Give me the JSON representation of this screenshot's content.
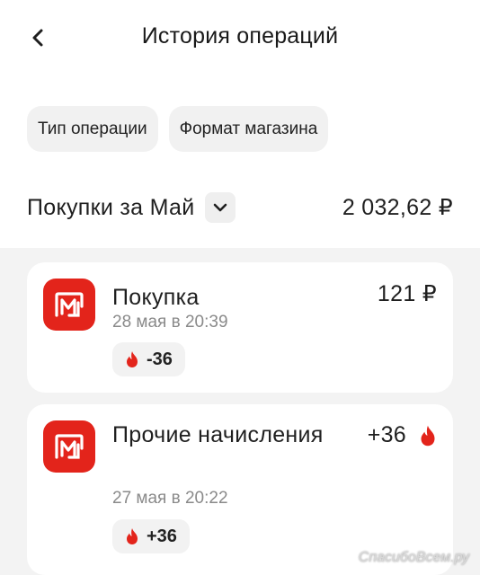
{
  "header": {
    "title": "История операций"
  },
  "filters": [
    {
      "label": "Тип операции"
    },
    {
      "label": "Формат магазина"
    }
  ],
  "summary": {
    "title": "Покупки за Май",
    "total": "2 032,62 ₽"
  },
  "operations": [
    {
      "title": "Покупка",
      "date": "28 мая в 20:39",
      "amount": "121 ₽",
      "bonus": "-36"
    },
    {
      "title": "Прочие начисления",
      "date": "27 мая в 20:22",
      "amount": "+36",
      "bonus": "+36"
    }
  ],
  "colors": {
    "brand_red": "#e3241b",
    "card_bg": "#ffffff",
    "list_bg": "#f3f3f3",
    "chip_bg": "#f1f1f1"
  },
  "icons": {
    "back": "chevron-left-icon",
    "dropdown": "chevron-down-icon",
    "logo": "magnit-logo-icon",
    "bonus": "flame-icon"
  },
  "watermark": "СпасибоВсем.ру"
}
